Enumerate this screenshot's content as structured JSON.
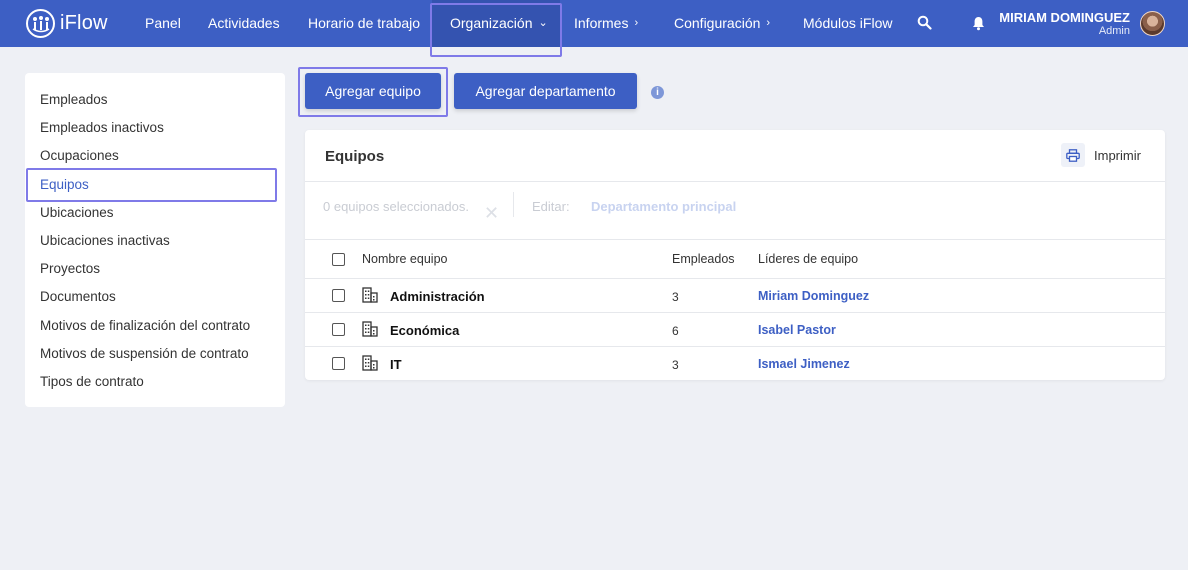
{
  "topbar": {
    "logo_text": "iFlow",
    "nav": [
      {
        "label": "Panel"
      },
      {
        "label": "Actividades"
      },
      {
        "label": "Horario de trabajo"
      },
      {
        "label": "Organización"
      },
      {
        "label": "Informes"
      },
      {
        "label": "Configuración"
      },
      {
        "label": "Módulos iFlow"
      }
    ],
    "user_name": "MIRIAM DOMINGUEZ",
    "user_role": "Admin"
  },
  "sidebar": {
    "items": [
      {
        "label": "Empleados"
      },
      {
        "label": "Empleados inactivos"
      },
      {
        "label": "Ocupaciones"
      },
      {
        "label": "Equipos"
      },
      {
        "label": "Ubicaciones"
      },
      {
        "label": "Ubicaciones inactivas"
      },
      {
        "label": "Proyectos"
      },
      {
        "label": "Documentos"
      },
      {
        "label": "Motivos de finalización del contrato"
      },
      {
        "label": "Motivos de suspensión de contrato"
      },
      {
        "label": "Tipos de contrato"
      }
    ]
  },
  "actions": {
    "add_team": "Agregar equipo",
    "add_department": "Agregar departamento"
  },
  "card": {
    "title": "Equipos",
    "print_label": "Imprimir",
    "bulk": {
      "selected_text": "0 equipos seleccionados.",
      "edit_label": "Editar:",
      "edit_option": "Departamento principal"
    },
    "columns": {
      "name": "Nombre equipo",
      "employees": "Empleados",
      "leaders": "Líderes de equipo"
    },
    "rows": [
      {
        "name": "Administración",
        "employees": "3",
        "leader": "Miriam Dominguez"
      },
      {
        "name": "Económica",
        "employees": "6",
        "leader": "Isabel Pastor"
      },
      {
        "name": "IT",
        "employees": "3",
        "leader": "Ismael Jimenez"
      }
    ]
  },
  "colors": {
    "primary": "#3d5fc4",
    "highlight": "#7f7ae8",
    "background": "#eef0f5"
  }
}
